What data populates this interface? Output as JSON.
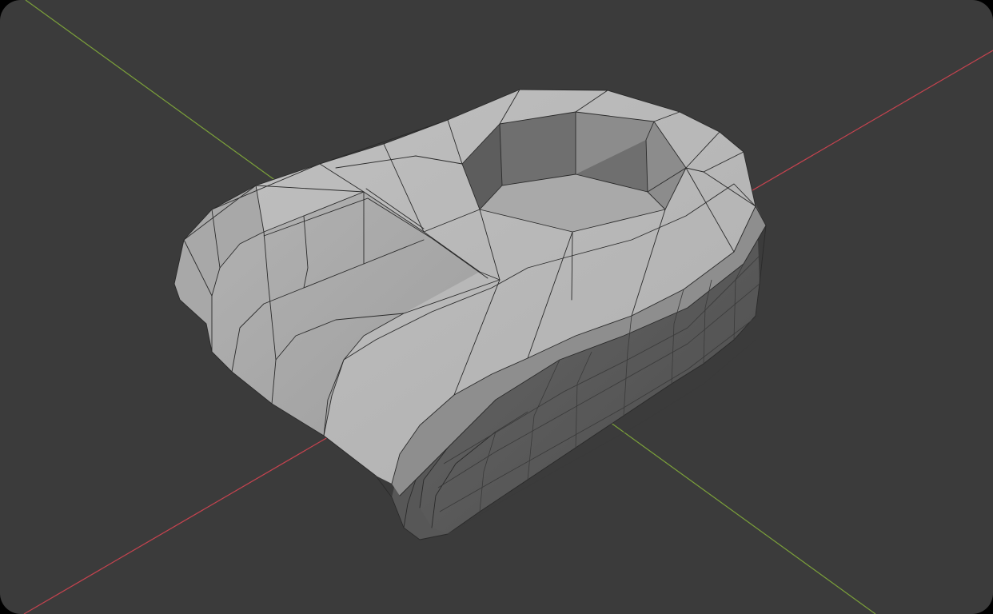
{
  "viewport": {
    "background_color": "#3b3b3b",
    "frame_color": "#000000"
  },
  "axes": {
    "x_axis_color": "#c4434f",
    "y_axis_color": "#7ba03a",
    "x_axis_label": "",
    "y_axis_label": ""
  },
  "object": {
    "shading": "solid",
    "overlay": "wireframe",
    "top_color": "#b9b9b9",
    "side_color": "#5e5e5e",
    "hole_wall_color": "#777777",
    "hole_floor_color": "#a9a9a9"
  }
}
